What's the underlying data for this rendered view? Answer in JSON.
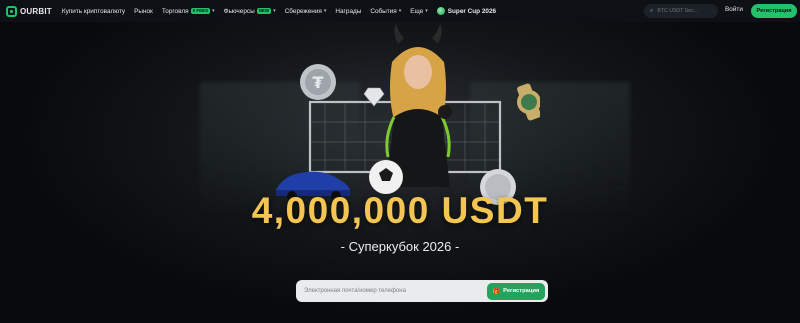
{
  "brand": {
    "name": "OURBIT"
  },
  "nav": {
    "items": [
      {
        "label": "Купить криптовалюту"
      },
      {
        "label": "Рынок"
      },
      {
        "label": "Торговля",
        "tag": "0 FEES",
        "dropdown": true
      },
      {
        "label": "Фьючерсы",
        "tag": "NEW",
        "dropdown": true
      },
      {
        "label": "Сбережения",
        "dropdown": true
      },
      {
        "label": "Награды"
      },
      {
        "label": "События",
        "dropdown": true
      },
      {
        "label": "Еще",
        "dropdown": true
      }
    ],
    "promo": "Super Cup 2026"
  },
  "search": {
    "placeholder": "BTC USDT Sec..."
  },
  "auth": {
    "login": "Войти",
    "register": "Регистрация"
  },
  "hero": {
    "prize": "4,000,000 USDT",
    "subtitle": "- Суперкубок 2026 -",
    "input_placeholder": "Электронная почта/номер телефона",
    "cta": "Регистрация"
  },
  "colors": {
    "accent": "#23c16b",
    "gold": "#f3c552",
    "bg": "#07090c"
  }
}
